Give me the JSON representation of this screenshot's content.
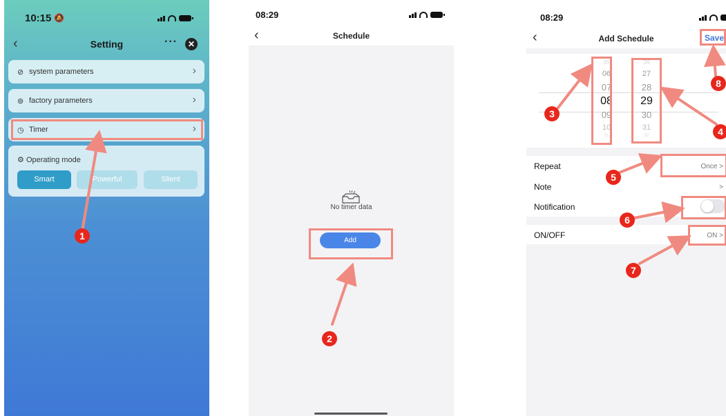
{
  "phone1": {
    "status_time": "10:15",
    "title": "Setting",
    "menu_dots": "···",
    "close_glyph": "✕",
    "items": [
      {
        "label": "system parameters",
        "icon": "gauge-icon"
      },
      {
        "label": "factory parameters",
        "icon": "settings-icon"
      },
      {
        "label": "Timer",
        "icon": "clock-icon"
      }
    ],
    "operating_mode": {
      "label": "Operating mode",
      "options": [
        "Smart",
        "Powerful",
        "Slient"
      ],
      "selected": "Smart"
    }
  },
  "phone2": {
    "status_time": "08:29",
    "title": "Schedule",
    "empty_text": "No timer data",
    "add_label": "Add"
  },
  "phone3": {
    "status_time": "08:29",
    "title": "Add Schedule",
    "save_label": "Save",
    "hours": [
      "05",
      "06",
      "07",
      "08",
      "09",
      "10",
      "11"
    ],
    "minutes": [
      "26",
      "27",
      "28",
      "29",
      "30",
      "31",
      "32"
    ],
    "selected_hour": "08",
    "selected_minute": "29",
    "rows": {
      "repeat": {
        "label": "Repeat",
        "value": "Once >"
      },
      "note": {
        "label": "Note",
        "value": ">"
      },
      "notification": {
        "label": "Notification",
        "enabled": false
      },
      "onoff": {
        "label": "ON/OFF",
        "value": "ON >"
      }
    }
  },
  "annotations": [
    "1",
    "2",
    "3",
    "4",
    "5",
    "6",
    "7",
    "8"
  ],
  "colors": {
    "highlight": "#f08a80",
    "badge": "#e8261b",
    "primary_button": "#4a86e8",
    "save_link": "#3f78d8"
  }
}
